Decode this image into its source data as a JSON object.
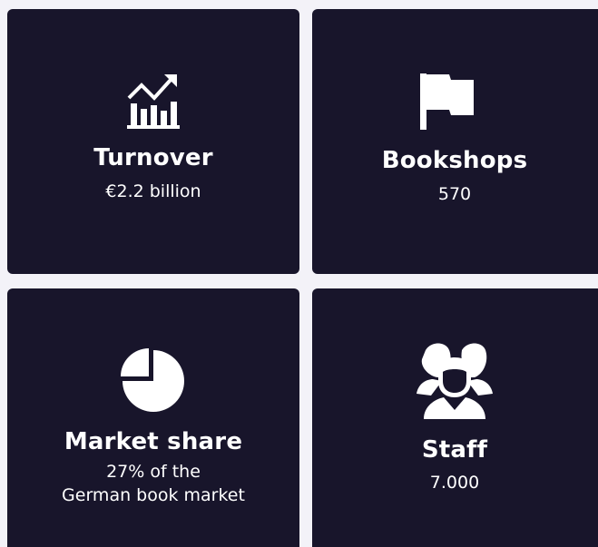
{
  "colors": {
    "background": "#f3f2f8",
    "card": "#18152b",
    "text": "#ffffff"
  },
  "cards": [
    {
      "icon": "growth-chart-icon",
      "title": "Turnover",
      "value": "€2.2 billion"
    },
    {
      "icon": "flag-icon",
      "title": "Bookshops",
      "value": "570"
    },
    {
      "icon": "pie-chart-icon",
      "title": "Market share",
      "value_line1": "27% of the",
      "value_line2": "German book market"
    },
    {
      "icon": "people-icon",
      "title": "Staff",
      "value": "7.000"
    }
  ]
}
